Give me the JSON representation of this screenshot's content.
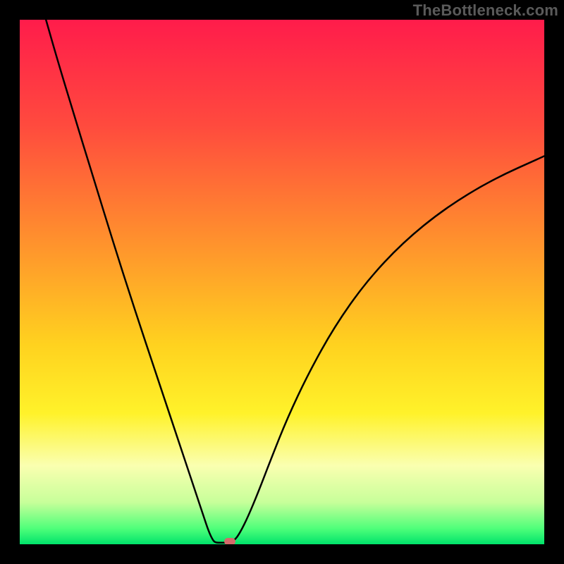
{
  "attribution": "TheBottleneck.com",
  "chart_data": {
    "type": "line",
    "title": "",
    "xlabel": "",
    "ylabel": "",
    "xlim": [
      0,
      100
    ],
    "ylim": [
      0,
      100
    ],
    "gradient_stops": [
      {
        "offset": 0,
        "color": "#ff1c4b"
      },
      {
        "offset": 20,
        "color": "#ff4a3e"
      },
      {
        "offset": 45,
        "color": "#ff9a2b"
      },
      {
        "offset": 62,
        "color": "#ffd21f"
      },
      {
        "offset": 75,
        "color": "#fff22a"
      },
      {
        "offset": 85,
        "color": "#faffb0"
      },
      {
        "offset": 92,
        "color": "#c7ff9a"
      },
      {
        "offset": 97,
        "color": "#4fff7a"
      },
      {
        "offset": 100,
        "color": "#00e36b"
      }
    ],
    "series": [
      {
        "name": "bottleneck-curve",
        "stroke": "#000000",
        "stroke_width": 2.5,
        "points": [
          {
            "x": 5.0,
            "y": 100.0
          },
          {
            "x": 7.0,
            "y": 93.0
          },
          {
            "x": 10.0,
            "y": 83.0
          },
          {
            "x": 14.0,
            "y": 70.0
          },
          {
            "x": 18.0,
            "y": 57.0
          },
          {
            "x": 22.0,
            "y": 44.5
          },
          {
            "x": 26.0,
            "y": 32.5
          },
          {
            "x": 29.0,
            "y": 23.5
          },
          {
            "x": 31.5,
            "y": 16.0
          },
          {
            "x": 33.5,
            "y": 10.0
          },
          {
            "x": 35.0,
            "y": 5.5
          },
          {
            "x": 36.0,
            "y": 2.5
          },
          {
            "x": 36.8,
            "y": 0.8
          },
          {
            "x": 37.3,
            "y": 0.3
          },
          {
            "x": 38.5,
            "y": 0.3
          },
          {
            "x": 40.0,
            "y": 0.3
          },
          {
            "x": 41.0,
            "y": 0.8
          },
          {
            "x": 42.0,
            "y": 2.2
          },
          {
            "x": 43.5,
            "y": 5.2
          },
          {
            "x": 45.5,
            "y": 10.0
          },
          {
            "x": 48.0,
            "y": 16.5
          },
          {
            "x": 51.0,
            "y": 24.0
          },
          {
            "x": 55.0,
            "y": 32.5
          },
          {
            "x": 60.0,
            "y": 41.5
          },
          {
            "x": 66.0,
            "y": 50.0
          },
          {
            "x": 73.0,
            "y": 57.5
          },
          {
            "x": 81.0,
            "y": 64.0
          },
          {
            "x": 90.0,
            "y": 69.5
          },
          {
            "x": 100.0,
            "y": 74.0
          }
        ]
      }
    ],
    "marker": {
      "x": 40.0,
      "y": 0.5,
      "color": "#d46a6a",
      "shape": "pill"
    }
  }
}
